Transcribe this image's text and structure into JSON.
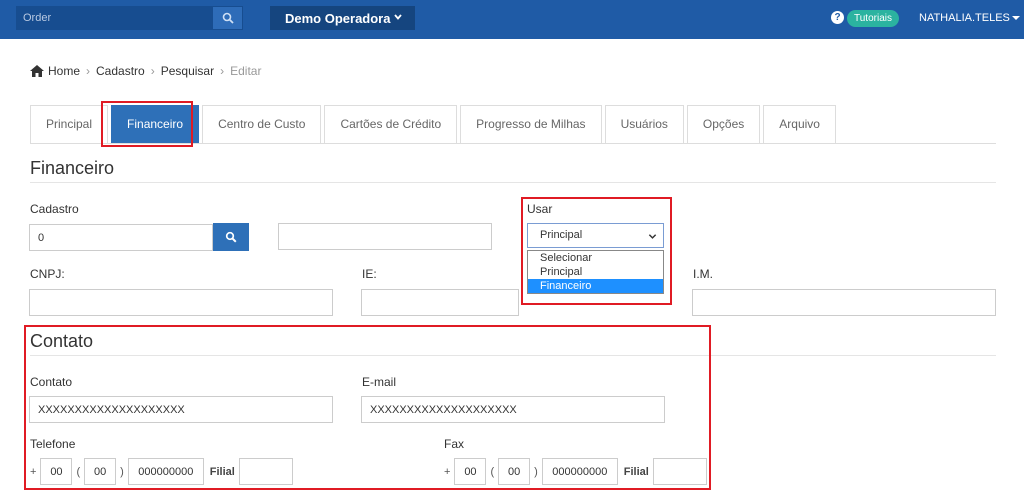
{
  "topbar": {
    "search_placeholder": "Order",
    "operator": "Demo Operadora",
    "tutorial_label": "Tutoriais",
    "user_name": "NATHALIA.TELES"
  },
  "breadcrumb": {
    "home": "Home",
    "items": [
      "Cadastro",
      "Pesquisar"
    ],
    "current": "Editar"
  },
  "tabs": [
    {
      "label": "Principal"
    },
    {
      "label": "Financeiro",
      "active": true
    },
    {
      "label": "Centro de Custo"
    },
    {
      "label": "Cartões de Crédito"
    },
    {
      "label": "Progresso de Milhas"
    },
    {
      "label": "Usuários"
    },
    {
      "label": "Opções"
    },
    {
      "label": "Arquivo"
    }
  ],
  "financeiro": {
    "title": "Financeiro",
    "cadastro_label": "Cadastro",
    "cadastro_value": "0",
    "cadastro_name_value": "",
    "usar_label": "Usar",
    "usar_selected": "Principal",
    "usar_options": [
      "Selecionar",
      "Principal",
      "Financeiro"
    ],
    "usar_highlighted": "Financeiro",
    "cnpj_label": "CNPJ:",
    "cnpj_value": "",
    "ie_label": "IE:",
    "ie_value": "",
    "im_label": "I.M.",
    "im_value": ""
  },
  "contato": {
    "title": "Contato",
    "contato_label": "Contato",
    "contato_value": "XXXXXXXXXXXXXXXXXXXX",
    "email_label": "E-mail",
    "email_value": "XXXXXXXXXXXXXXXXXXXX",
    "telefone_label": "Telefone",
    "fax_label": "Fax",
    "phone": {
      "plus": "+",
      "country": "00",
      "area": "00",
      "number": "000000000",
      "filial_label": "Filial",
      "filial": ""
    },
    "fax": {
      "plus": "+",
      "country": "00",
      "area": "00",
      "number": "000000000",
      "filial_label": "Filial",
      "filial": ""
    }
  },
  "colors": {
    "navbar": "#1f5ba6",
    "accent": "#2e70b8",
    "highlight_box": "#e01b24",
    "tutorial_badge": "#2bb3a0"
  }
}
